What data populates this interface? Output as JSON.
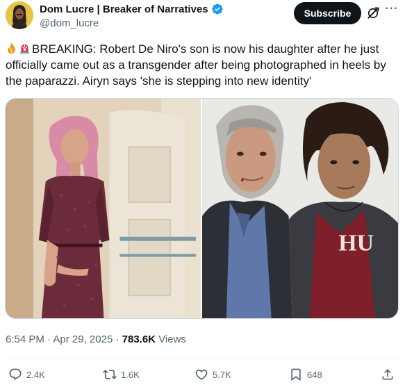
{
  "author": {
    "display_name": "Dom Lucre | Breaker of Narratives",
    "handle": "@dom_lucre",
    "verified": true,
    "verified_color": "#1d9bf0"
  },
  "header": {
    "subscribe_label": "Subscribe",
    "grok_icon": "grok-icon",
    "more_icon": "more-icon",
    "more_glyph": "···"
  },
  "tweet": {
    "emojis": [
      "fire",
      "rotating-light"
    ],
    "text": "BREAKING: Robert De Niro's son is now his daughter after he just officially came out as a transgender after being photographed in heels by the paparazzi. Airyn says 'she is stepping into new identity'"
  },
  "media": {
    "photos": [
      {
        "name": "photo-person-pink-hair-burgundy-dress"
      },
      {
        "name": "photo-two-men-portrait"
      }
    ],
    "shirt_text": "HU"
  },
  "meta": {
    "time": "6:54 PM",
    "separator": "·",
    "date": "Apr 29, 2025",
    "views_count": "783.6K",
    "views_label": "Views"
  },
  "actions": {
    "replies": "2.4K",
    "reposts": "1.6K",
    "likes": "5.7K",
    "bookmarks": "648"
  },
  "colors": {
    "text_primary": "#0f1419",
    "text_secondary": "#536471",
    "verified_blue": "#1d9bf0",
    "subscribe_bg": "#0f1419"
  }
}
